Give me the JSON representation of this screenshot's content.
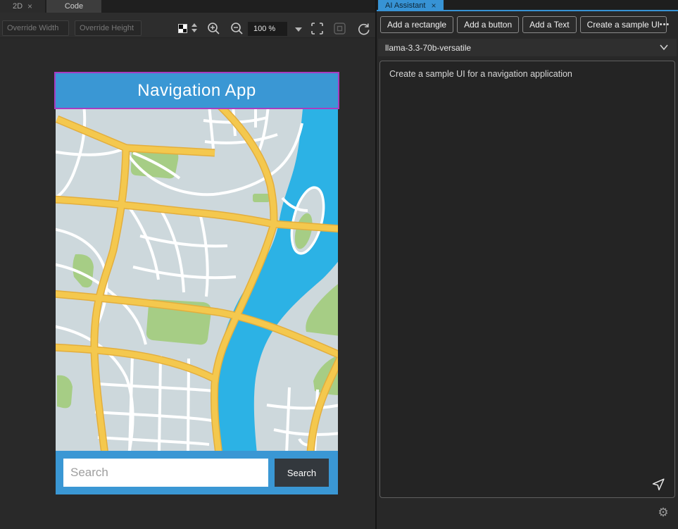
{
  "colors": {
    "accent": "#3793d5",
    "panel_bg": "#282828",
    "canvas_bg": "#292929",
    "toolbar_bg": "#2d2d2d",
    "tabbar_bg": "#1f1f1f",
    "header_blue": "#3a97d4",
    "selection_purple": "#a83cc0",
    "map_bg": "#cdd8dc",
    "road_yellow": "#f4c84e",
    "road_yellow_edge": "#e3ae3d",
    "park_green": "#a6cd85",
    "river_blue": "#2cb2e5",
    "search_btn_bg": "#33383d"
  },
  "icons": {
    "close": "×",
    "more": "•••",
    "gear": "⚙"
  },
  "left": {
    "tabs": {
      "design": "2D",
      "code": "Code"
    },
    "toolbar": {
      "override_width": "Override Width",
      "override_height": "Override Height",
      "zoom_level": "100 %"
    }
  },
  "preview": {
    "title": "Navigation App",
    "search_placeholder": "Search",
    "search_button": "Search"
  },
  "ai": {
    "tab": "AI Assistant",
    "actions": [
      "Add a rectangle",
      "Add a button",
      "Add a Text",
      "Create a sample UI"
    ],
    "model": "llama-3.3-70b-versatile",
    "prompt": "Create a sample UI for a navigation application"
  }
}
